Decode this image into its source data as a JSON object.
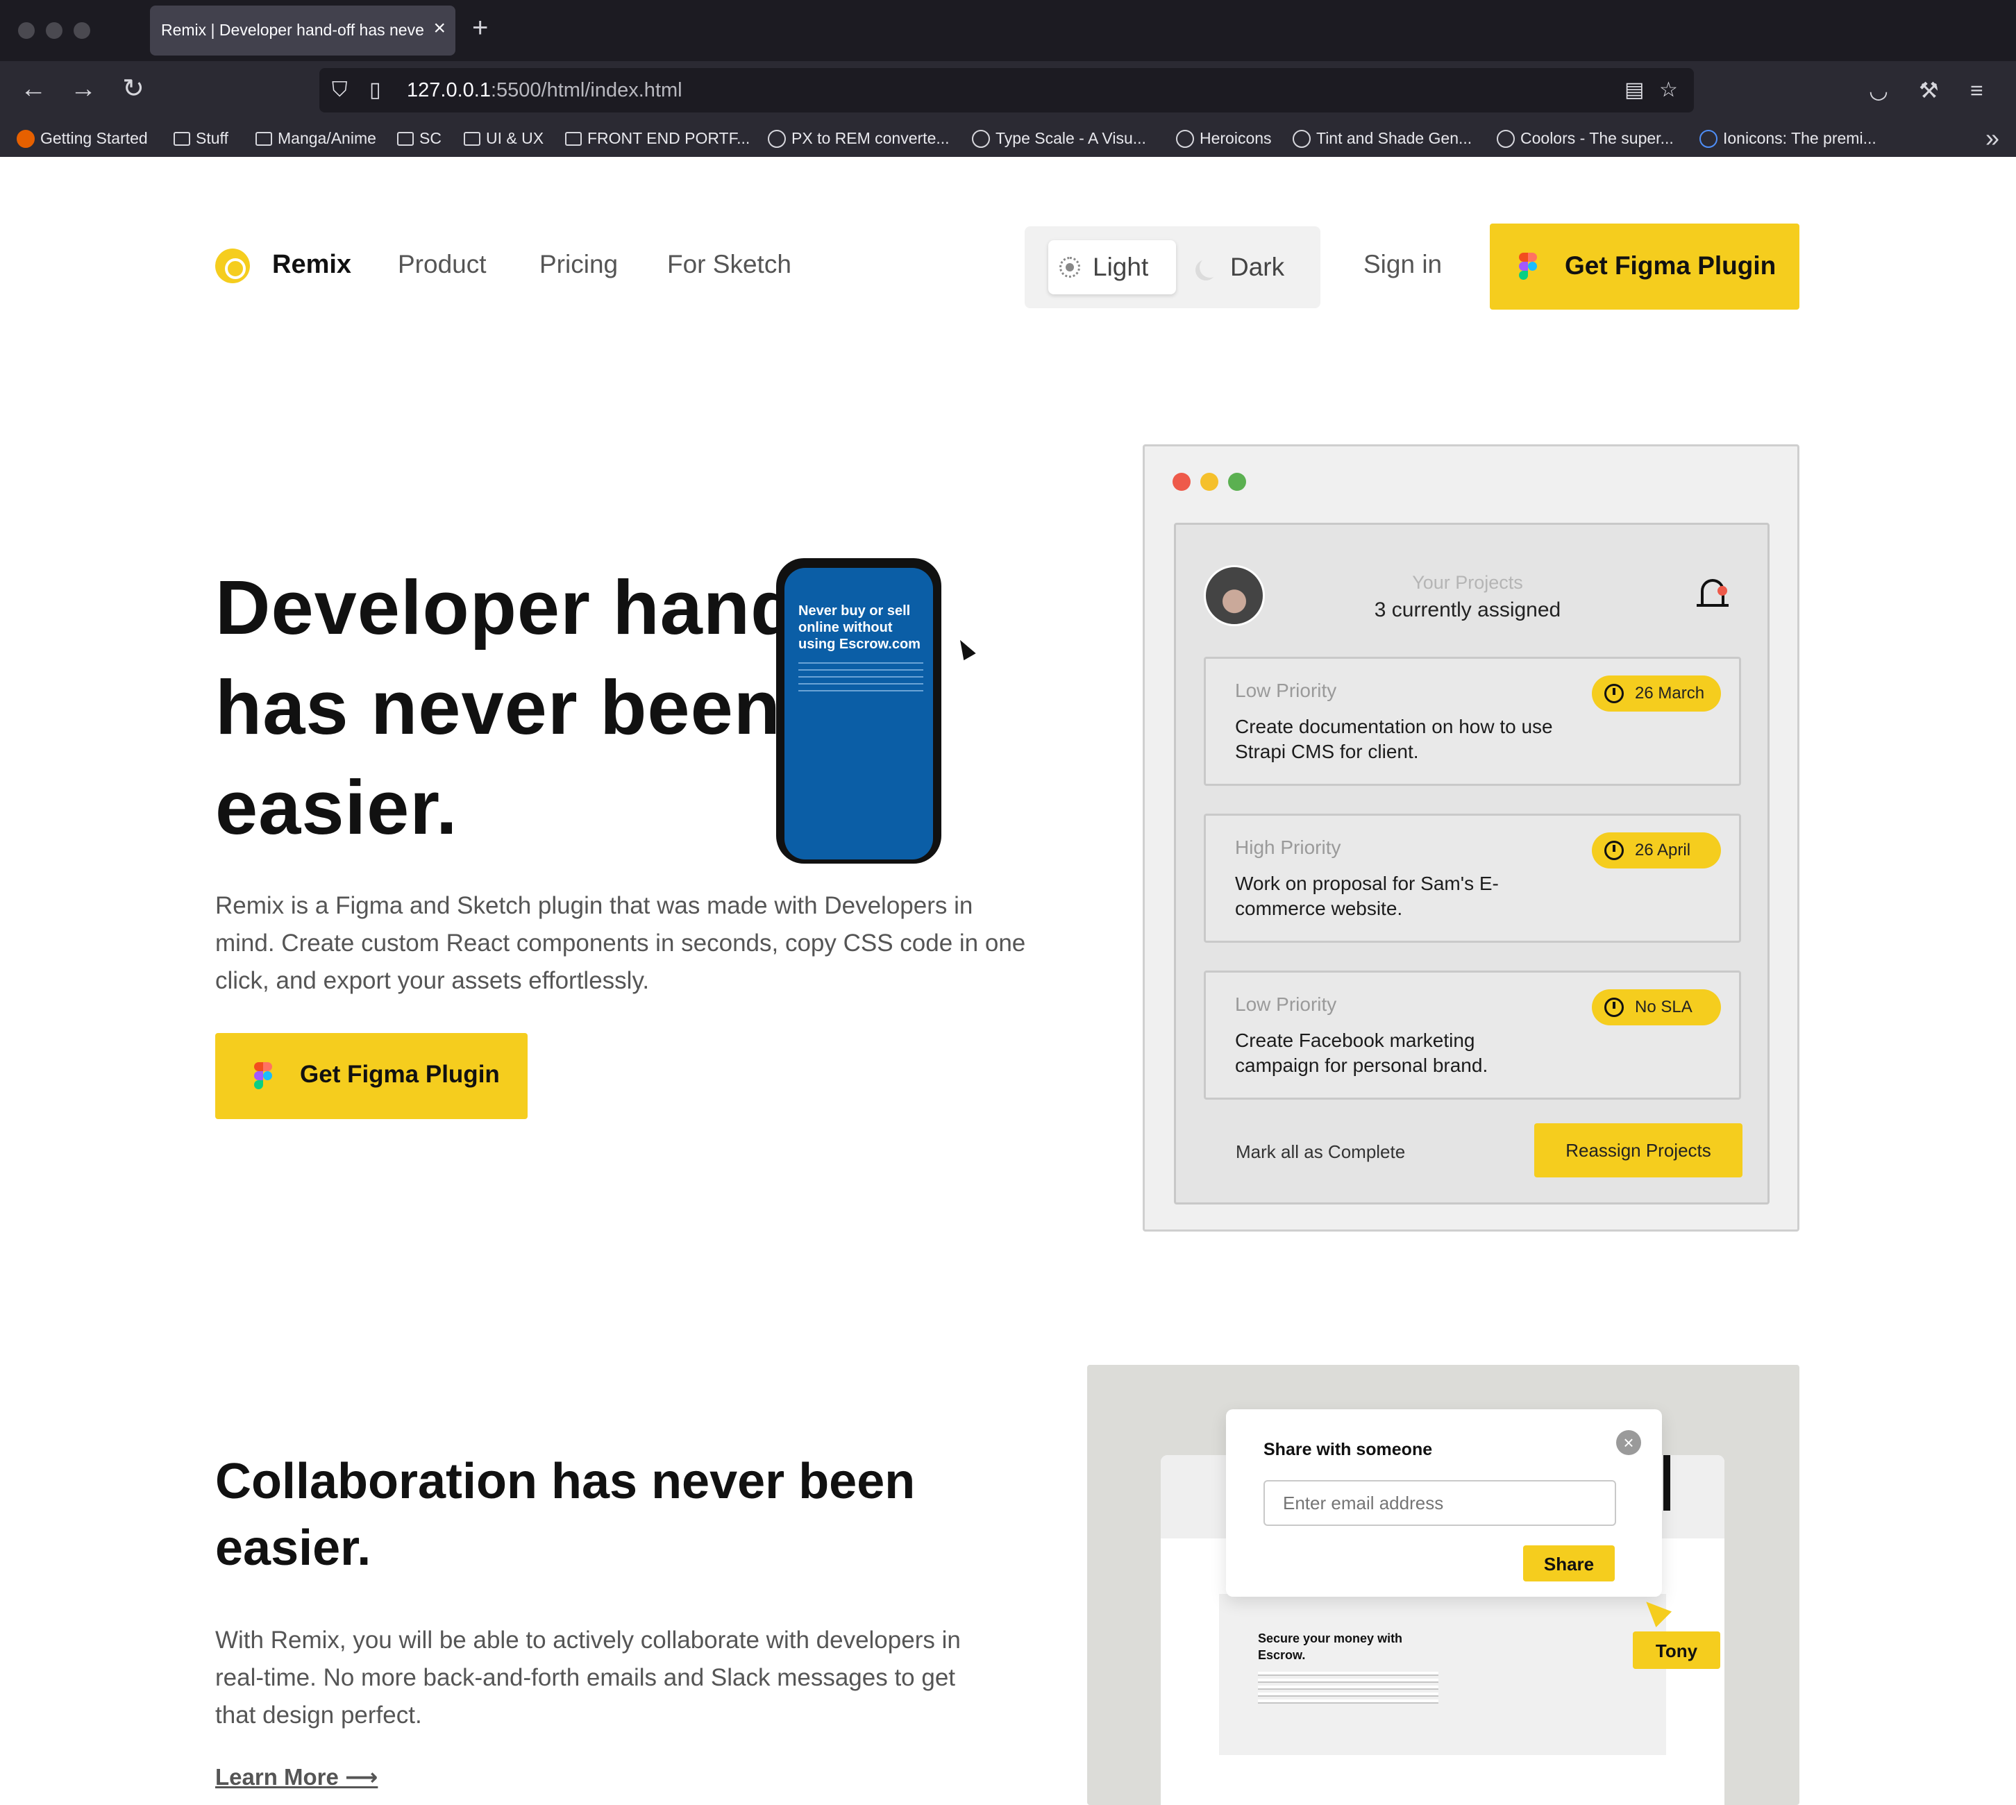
{
  "browser": {
    "tab_title": "Remix | Developer hand-off has never been easier",
    "tab_close": "×",
    "new_tab": "+",
    "url_host": "127.0.0.1",
    "url_rest": ":5500/html/index.html",
    "icons": [
      "back-arrow-icon",
      "forward-arrow-icon",
      "reload-icon",
      "shield-icon",
      "page-icon",
      "reader-view-icon",
      "bookmark-star-icon",
      "pocket-icon",
      "wrench-icon",
      "menu-icon"
    ],
    "bookmarks": [
      "Getting Started",
      "Stuff",
      "Manga/Anime",
      "SC",
      "UI & UX",
      "FRONT END PORTF...",
      "PX to REM converte...",
      "Type Scale - A Visu...",
      "Heroicons",
      "Tint and Shade Gen...",
      "Coolors - The super...",
      "Ionicons: The premi..."
    ],
    "bookmarks_more": "»"
  },
  "nav": {
    "brand": "Remix",
    "links": [
      "Product",
      "Pricing",
      "For Sketch"
    ],
    "theme_light": "Light",
    "theme_dark": "Dark",
    "sign_in": "Sign in",
    "cta": "Get Figma Plugin"
  },
  "hero": {
    "title": "Developer hand-off has never been easier.",
    "description": "Remix is a Figma and Sketch plugin that was made with Developers in mind. Create custom React components in seconds, copy CSS code in one click, and export your assets effortlessly.",
    "cta": "Get Figma Plugin"
  },
  "mock": {
    "projects_title": "Your Projects",
    "projects_sub": "3 currently assigned",
    "tasks": [
      {
        "priority": "Low Priority",
        "text": "Create documentation on how to use Strapi CMS for client.",
        "badge": "26 March"
      },
      {
        "priority": "High Priority",
        "text": "Work on proposal for Sam's E-commerce website.",
        "badge": "26 April"
      },
      {
        "priority": "Low Priority",
        "text": "Create Facebook marketing campaign for personal brand.",
        "badge": "No SLA"
      }
    ],
    "mark_all": "Mark all as Complete",
    "reassign": "Reassign Projects"
  },
  "collab": {
    "title": "Collaboration has never been easier.",
    "description": "With Remix, you will be able to actively collaborate with developers in real-time. No more back-and-forth emails and Slack messages to get that design perfect.",
    "learn_more": "Learn More ⟶",
    "share_title": "Share with someone",
    "share_placeholder": "Enter email address",
    "share_button": "Share",
    "close_glyph": "×",
    "site_headline": "Secure your money with Escrow.",
    "phone_headline": "Never buy or sell online without using Escrow.com",
    "cursor_name": "Tony"
  },
  "colors": {
    "accent": "#f5cd1e",
    "chrome_dark": "#1c1b22",
    "chrome_mid": "#2b2a33",
    "mac_red": "#ee5a4a",
    "mac_yellow": "#f5c02c",
    "mac_green": "#5bb051"
  }
}
